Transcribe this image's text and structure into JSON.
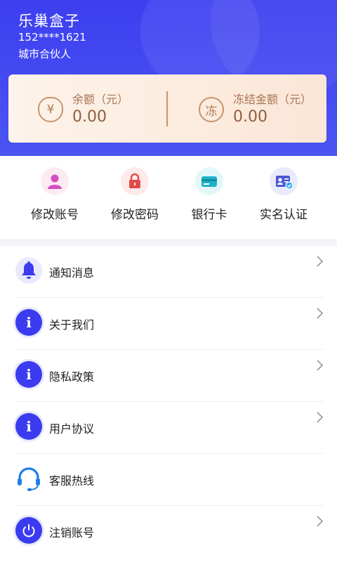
{
  "colors": {
    "primary": "#3d3ff0",
    "gold": "#a77452",
    "card_bg": "#fcefe3"
  },
  "user": {
    "name": "乐巢盒子",
    "phone": "152****1621",
    "role": "城市合伙人"
  },
  "balance": {
    "available": {
      "icon": "yen-bag-icon",
      "symbol": "¥",
      "label": "余额（元）",
      "value": "0.00"
    },
    "frozen": {
      "icon": "frozen-icon",
      "symbol": "冻",
      "label": "冻结金额（元）",
      "value": "0.00"
    }
  },
  "quick_actions": [
    {
      "label": "修改账号",
      "icon": "user-icon"
    },
    {
      "label": "修改密码",
      "icon": "lock-icon"
    },
    {
      "label": "银行卡",
      "icon": "bank-card-icon"
    },
    {
      "label": "实名认证",
      "icon": "id-card-icon"
    }
  ],
  "menu": [
    {
      "label": "通知消息",
      "icon": "bell-icon"
    },
    {
      "label": "关于我们",
      "icon": "info-icon"
    },
    {
      "label": "隐私政策",
      "icon": "info-icon"
    },
    {
      "label": "用户协议",
      "icon": "info-icon"
    },
    {
      "label": "客服热线",
      "icon": "headset-icon"
    },
    {
      "label": "注销账号",
      "icon": "power-icon"
    }
  ]
}
